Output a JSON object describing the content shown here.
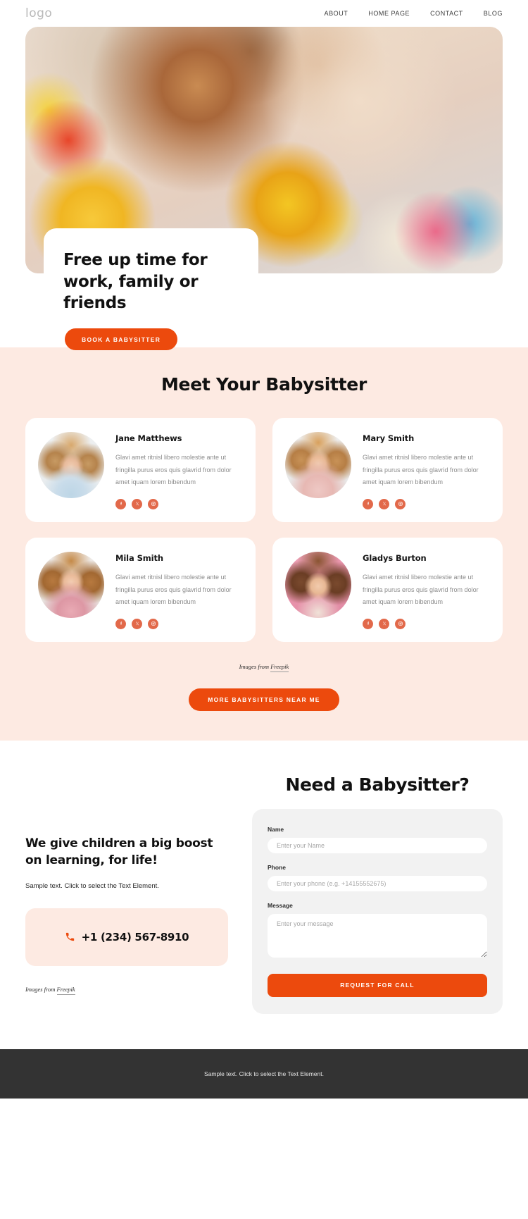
{
  "header": {
    "logo": "logo",
    "nav": [
      {
        "label": "ABOUT"
      },
      {
        "label": "HOME PAGE"
      },
      {
        "label": "CONTACT"
      },
      {
        "label": "BLOG"
      }
    ]
  },
  "hero": {
    "title": "Free up time  for work, family or friends",
    "cta_label": "Book a babysitter"
  },
  "meet": {
    "title": "Meet Your Babysitter",
    "credit_prefix": "Images from ",
    "credit_link": "Freepik",
    "cta_label": "More babysitters near me",
    "cards": [
      {
        "name": "Jane Matthews",
        "text": "Glavi amet ritnisl libero molestie ante ut fringilla purus eros quis glavrid from dolor amet iquam lorem bibendum",
        "socials": [
          "facebook-icon",
          "x-twitter-icon",
          "instagram-icon"
        ]
      },
      {
        "name": "Mary Smith",
        "text": "Glavi amet ritnisl libero molestie ante ut fringilla purus eros quis glavrid from dolor amet iquam lorem bibendum",
        "socials": [
          "facebook-icon",
          "x-twitter-icon",
          "instagram-icon"
        ]
      },
      {
        "name": "Mila Smith",
        "text": "Glavi amet ritnisl libero molestie ante ut fringilla purus eros quis glavrid from dolor amet iquam lorem bibendum",
        "socials": [
          "facebook-icon",
          "x-twitter-icon",
          "instagram-icon"
        ]
      },
      {
        "name": "Gladys Burton",
        "text": "Glavi amet ritnisl libero molestie ante ut fringilla purus eros quis glavrid from dolor amet iquam lorem bibendum",
        "socials": [
          "facebook-icon",
          "x-twitter-icon",
          "instagram-icon"
        ]
      }
    ]
  },
  "contact": {
    "left_title": "We give children a big boost on learning, for life!",
    "left_text": "Sample text. Click to select the Text Element.",
    "phone_number": "+1 (234) 567-8910",
    "credit_prefix": "Images from ",
    "credit_link": "Freepik",
    "form_title": "Need a Babysitter?",
    "fields": {
      "name_label": "Name",
      "name_placeholder": "Enter your Name",
      "phone_label": "Phone",
      "phone_placeholder": "Enter your phone (e.g. +14155552675)",
      "message_label": "Message",
      "message_placeholder": "Enter your message"
    },
    "submit_label": "Request for call"
  },
  "footer": {
    "text": "Sample text. Click to select the Text Element."
  },
  "colors": {
    "accent": "#ec4a0d",
    "soft_peach": "#fdeae2",
    "social": "#e2694a",
    "footer": "#333333"
  }
}
